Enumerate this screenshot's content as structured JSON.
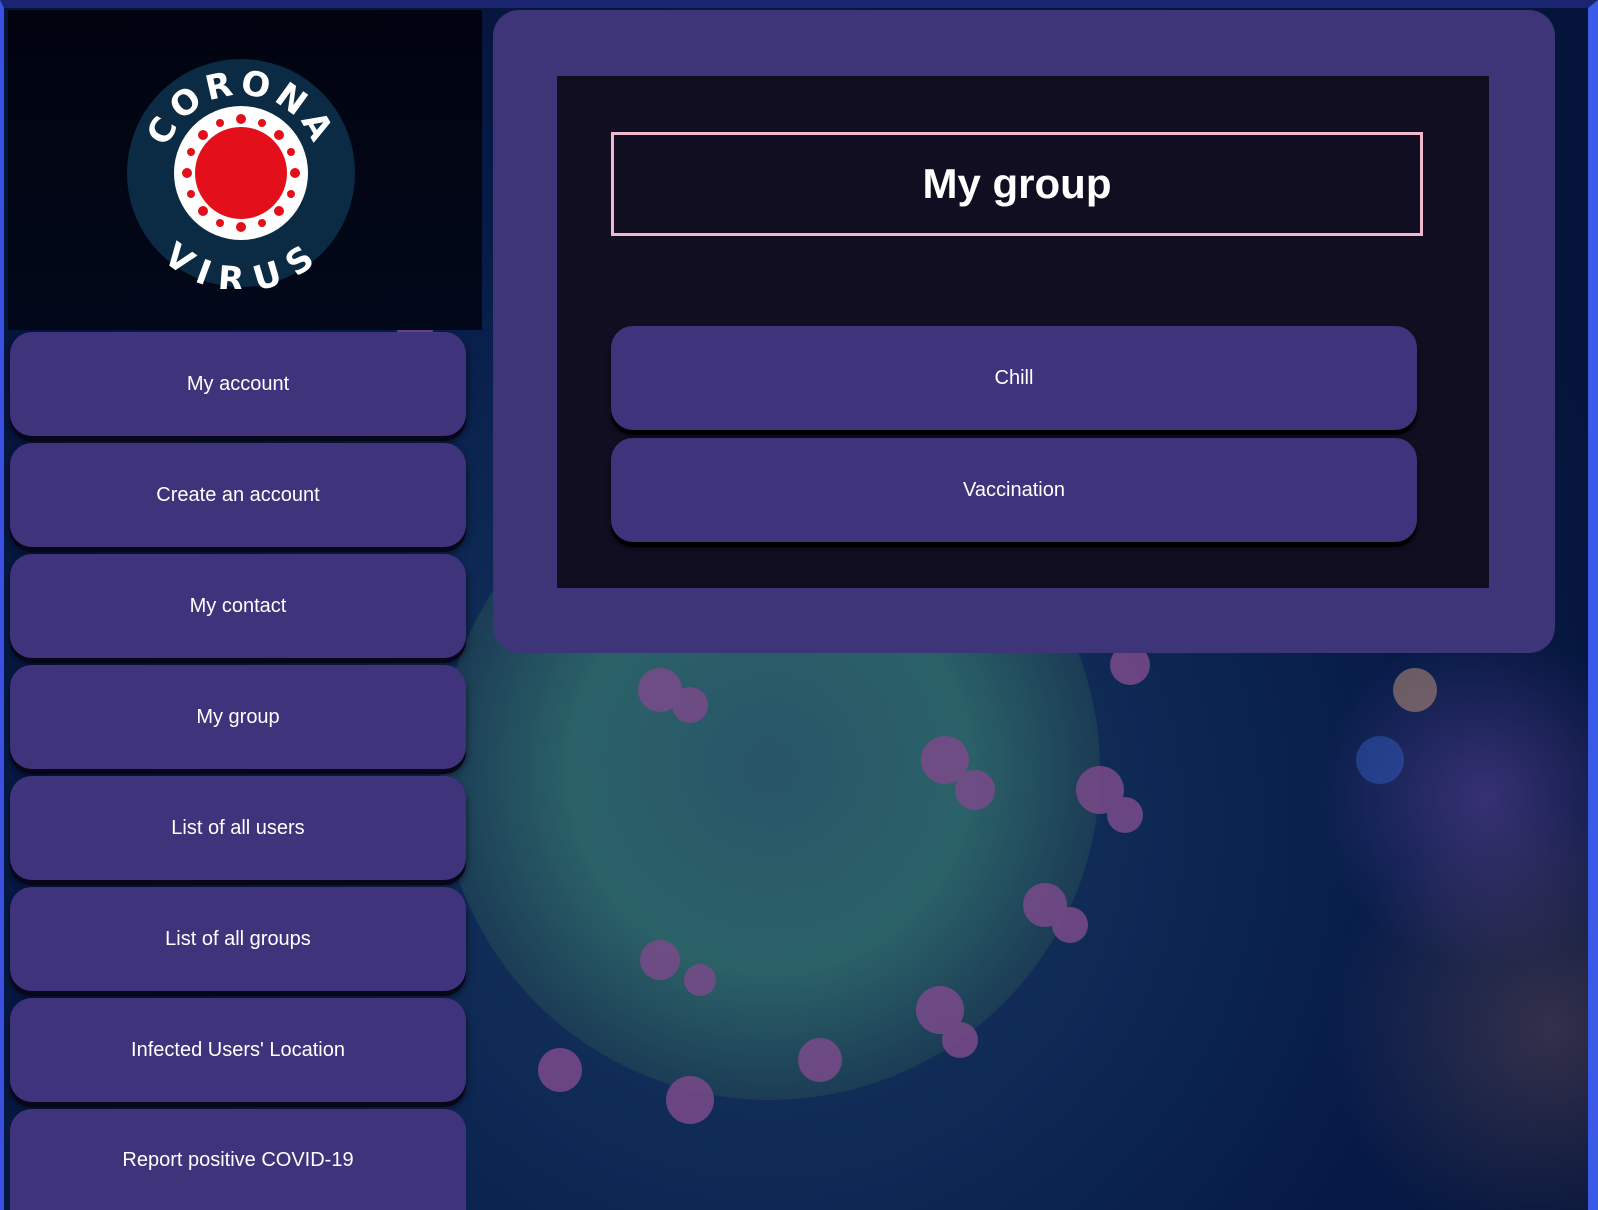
{
  "logo": {
    "top_text": "CORONA",
    "bottom_text": "VIRUS"
  },
  "sidebar": {
    "items": [
      {
        "label": "My account"
      },
      {
        "label": "Create an account"
      },
      {
        "label": "My contact"
      },
      {
        "label": "My group"
      },
      {
        "label": "List of all users"
      },
      {
        "label": "List of all groups"
      },
      {
        "label": "Infected Users' Location"
      },
      {
        "label": "Report positive COVID-19"
      }
    ]
  },
  "main": {
    "title": "My group",
    "groups": [
      {
        "label": "Chill"
      },
      {
        "label": "Vaccination"
      }
    ]
  },
  "colors": {
    "button": "#3f347c",
    "panel": "#3e3478",
    "inner": "#110e22",
    "title_border": "#f0b8cc",
    "logo_red": "#e3101b",
    "logo_navy": "#0b2a44"
  }
}
